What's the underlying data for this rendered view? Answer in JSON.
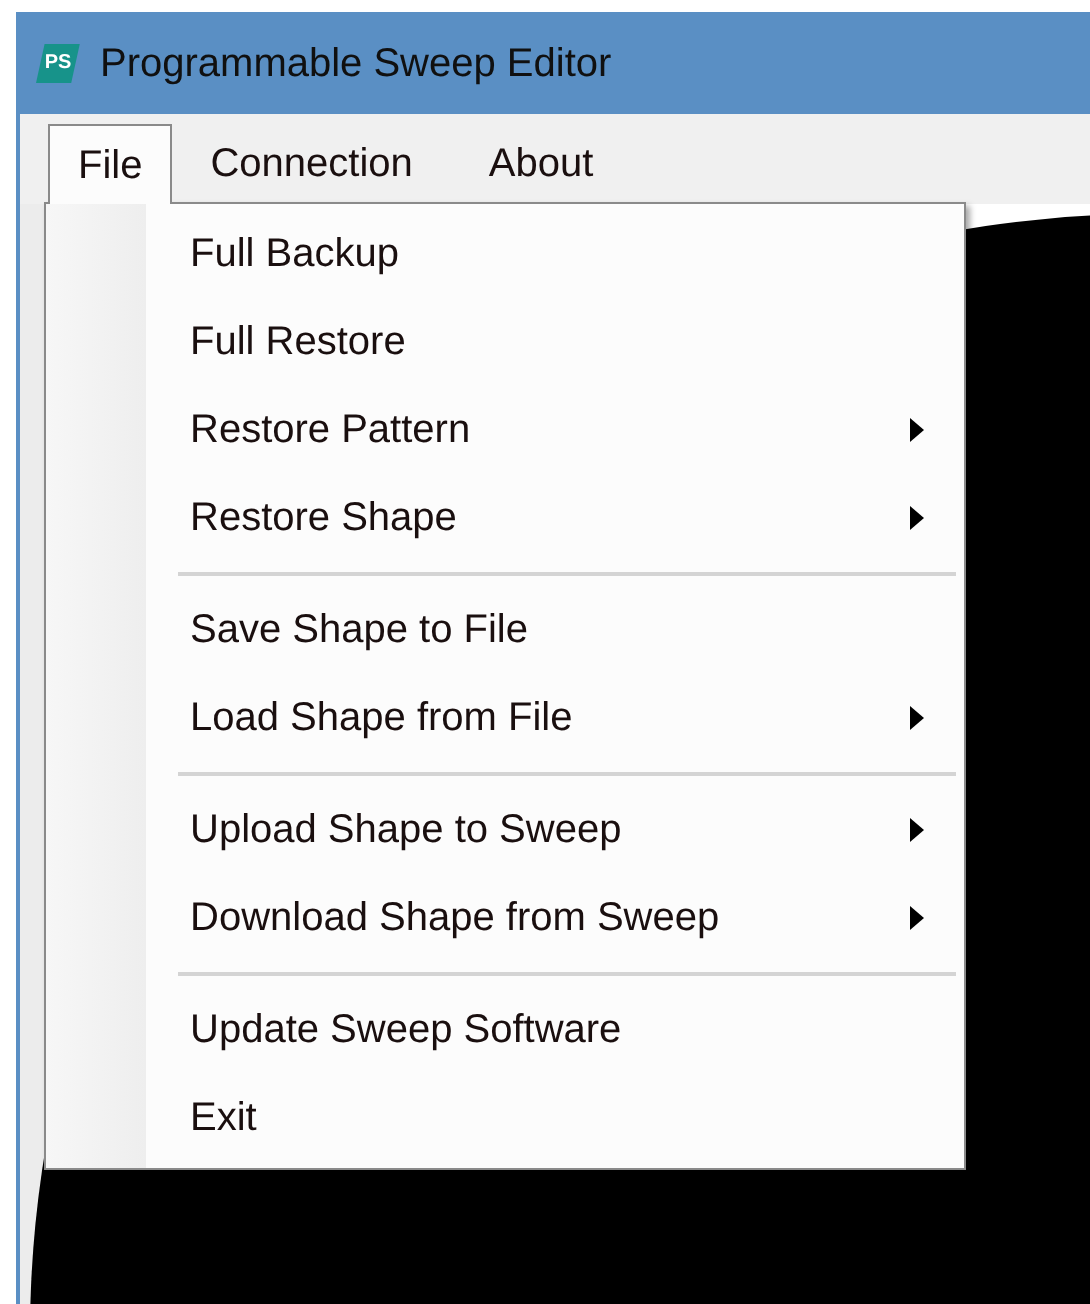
{
  "window": {
    "title": "Programmable Sweep Editor",
    "app_badge": "PS"
  },
  "menu_bar": [
    {
      "label": "File",
      "selected": true
    },
    {
      "label": "Connection",
      "selected": false
    },
    {
      "label": "About",
      "selected": false
    }
  ],
  "file_menu": [
    {
      "kind": "item",
      "label": "Full Backup",
      "submenu": false
    },
    {
      "kind": "item",
      "label": "Full Restore",
      "submenu": false
    },
    {
      "kind": "item",
      "label": "Restore Pattern",
      "submenu": true
    },
    {
      "kind": "item",
      "label": "Restore Shape",
      "submenu": true
    },
    {
      "kind": "separator"
    },
    {
      "kind": "item",
      "label": "Save Shape to File",
      "submenu": false
    },
    {
      "kind": "item",
      "label": "Load Shape from File",
      "submenu": true
    },
    {
      "kind": "separator"
    },
    {
      "kind": "item",
      "label": "Upload Shape to Sweep",
      "submenu": true
    },
    {
      "kind": "item",
      "label": "Download Shape from Sweep",
      "submenu": true
    },
    {
      "kind": "separator"
    },
    {
      "kind": "item",
      "label": "Update Sweep Software",
      "submenu": false
    },
    {
      "kind": "item",
      "label": "Exit",
      "submenu": false
    }
  ]
}
